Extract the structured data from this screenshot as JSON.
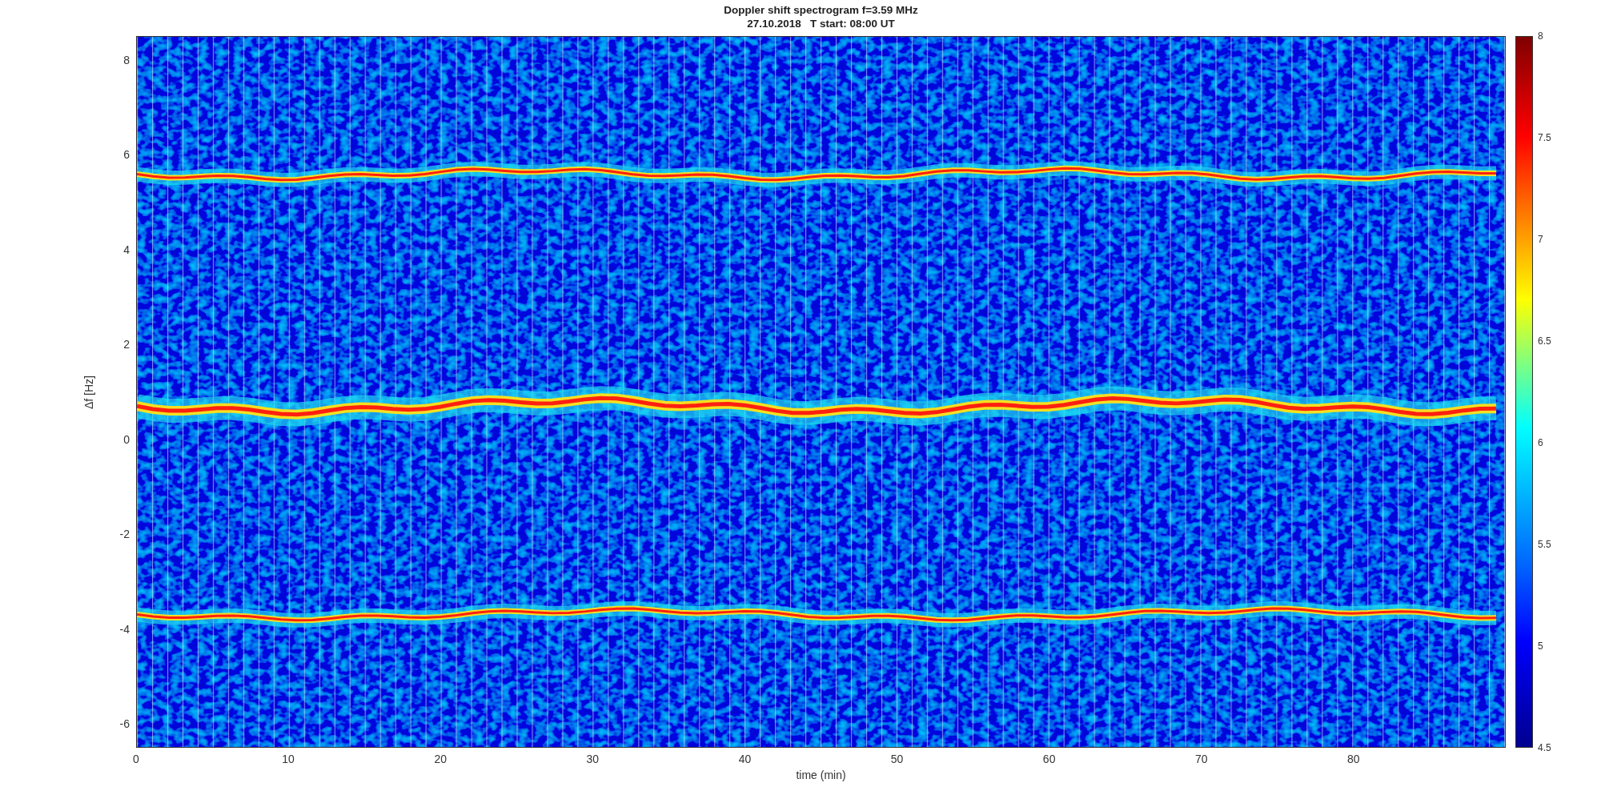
{
  "figure": {
    "title": "Doppler shift spectrogram f=3.59 MHz",
    "subtitle": "27.10.2018   T start: 08:00 UT"
  },
  "axes": {
    "ylabel": "Δf [Hz]",
    "xlabel": "time (min)",
    "yticks": [
      "8",
      "6",
      "4",
      "2",
      "0",
      "-2",
      "-4",
      "-6"
    ],
    "xticks": [
      "0",
      "10",
      "20",
      "30",
      "40",
      "50",
      "60",
      "70",
      "80"
    ]
  },
  "colorbar": {
    "ticks": [
      "8",
      "7.5",
      "7",
      "6.5",
      "6",
      "5.5",
      "5",
      "4.5"
    ]
  }
}
